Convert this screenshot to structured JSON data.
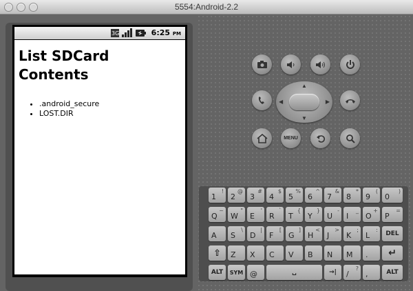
{
  "window": {
    "title": "5554:Android-2.2"
  },
  "status_bar": {
    "time": "6:25",
    "ampm": "PM",
    "icons": [
      "3g-icon",
      "signal-icon",
      "battery-icon"
    ]
  },
  "app": {
    "title": "List SDCard Contents",
    "items": [
      ".android_secure",
      "LOST.DIR"
    ]
  },
  "hw_buttons": {
    "row1": [
      "camera-icon",
      "volume-down-icon",
      "volume-up-icon",
      "power-icon"
    ],
    "row2": [
      "call-icon",
      "dpad",
      "end-call-icon"
    ],
    "row3": [
      "home-icon",
      "menu",
      "back-icon",
      "search-icon"
    ],
    "menu_label": "MENU"
  },
  "keyboard": {
    "row1": [
      [
        "1",
        "!"
      ],
      [
        "2",
        "@"
      ],
      [
        "3",
        "#"
      ],
      [
        "4",
        "$"
      ],
      [
        "5",
        "%"
      ],
      [
        "6",
        "^"
      ],
      [
        "7",
        "&"
      ],
      [
        "8",
        "*"
      ],
      [
        "9",
        "("
      ],
      [
        "0",
        ")"
      ]
    ],
    "row2": [
      [
        "Q",
        "~"
      ],
      [
        "W",
        "\""
      ],
      [
        "E",
        "'"
      ],
      [
        "R",
        "`"
      ],
      [
        "T",
        "{"
      ],
      [
        "Y",
        "}"
      ],
      [
        "U",
        "-"
      ],
      [
        "I",
        "_"
      ],
      [
        "O",
        "+"
      ],
      [
        "P",
        "="
      ]
    ],
    "row3": [
      [
        "A",
        ""
      ],
      [
        "S",
        "\\"
      ],
      [
        "D",
        "|"
      ],
      [
        "F",
        "["
      ],
      [
        "G",
        "]"
      ],
      [
        "H",
        "<"
      ],
      [
        "J",
        ">"
      ],
      [
        "K",
        ";"
      ],
      [
        "L",
        ":"
      ],
      [
        "DEL",
        ""
      ]
    ],
    "row4": [
      [
        "⇧",
        ""
      ],
      [
        "Z",
        ""
      ],
      [
        "X",
        ""
      ],
      [
        "C",
        ""
      ],
      [
        "V",
        ""
      ],
      [
        "B",
        ""
      ],
      [
        "N",
        ""
      ],
      [
        "M",
        ""
      ],
      [
        ".",
        ""
      ],
      [
        "↵",
        ""
      ]
    ],
    "row5": [
      [
        "ALT",
        ""
      ],
      [
        "SYM",
        ""
      ],
      [
        "@",
        ""
      ],
      [
        "␣",
        ""
      ],
      [
        "→|",
        ""
      ],
      [
        "/",
        "?"
      ],
      [
        ",",
        ""
      ],
      [
        "ALT",
        ""
      ]
    ]
  }
}
